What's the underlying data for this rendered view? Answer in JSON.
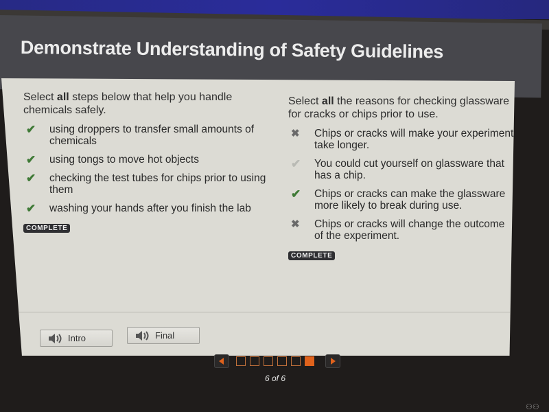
{
  "header": {
    "title": "Demonstrate Understanding of Safety Guidelines"
  },
  "left_question": {
    "prompt_prefix": "Select ",
    "prompt_bold": "all",
    "prompt_suffix": " steps below that help you handle chemicals safely.",
    "options": [
      {
        "mark": "correct",
        "icon": "check-icon",
        "text": "using droppers to transfer small amounts of chemicals"
      },
      {
        "mark": "correct",
        "icon": "check-icon",
        "text": "using tongs to move hot objects"
      },
      {
        "mark": "correct",
        "icon": "check-icon",
        "text": "checking the test tubes for chips prior to using them"
      },
      {
        "mark": "correct",
        "icon": "check-icon",
        "text": "washing your hands after you finish the lab"
      }
    ],
    "status": "COMPLETE"
  },
  "right_question": {
    "prompt_prefix": "Select ",
    "prompt_bold": "all",
    "prompt_suffix": " the reasons for checking glassware for cracks or chips prior to use.",
    "options": [
      {
        "mark": "wrong",
        "icon": "x-icon",
        "text": "Chips or cracks will make your experiment take longer."
      },
      {
        "mark": "correct-muted",
        "icon": "check-icon",
        "text": "You could cut yourself on glassware that has a chip."
      },
      {
        "mark": "correct",
        "icon": "check-icon",
        "text": "Chips or cracks can make the glassware more likely to break during use."
      },
      {
        "mark": "wrong",
        "icon": "x-icon",
        "text": "Chips or cracks will change the outcome of the experiment."
      }
    ],
    "status": "COMPLETE"
  },
  "footer": {
    "intro_label": "Intro",
    "final_label": "Final"
  },
  "navigation": {
    "current_page": 6,
    "total_pages": 6,
    "page_label": "6 of 6",
    "colors": {
      "active": "#e0621c",
      "inactive_border": "#c1703a"
    }
  },
  "colors": {
    "check_green": "#3f7a36",
    "header_bg": "#47474c",
    "content_bg": "#dcdbd4"
  }
}
